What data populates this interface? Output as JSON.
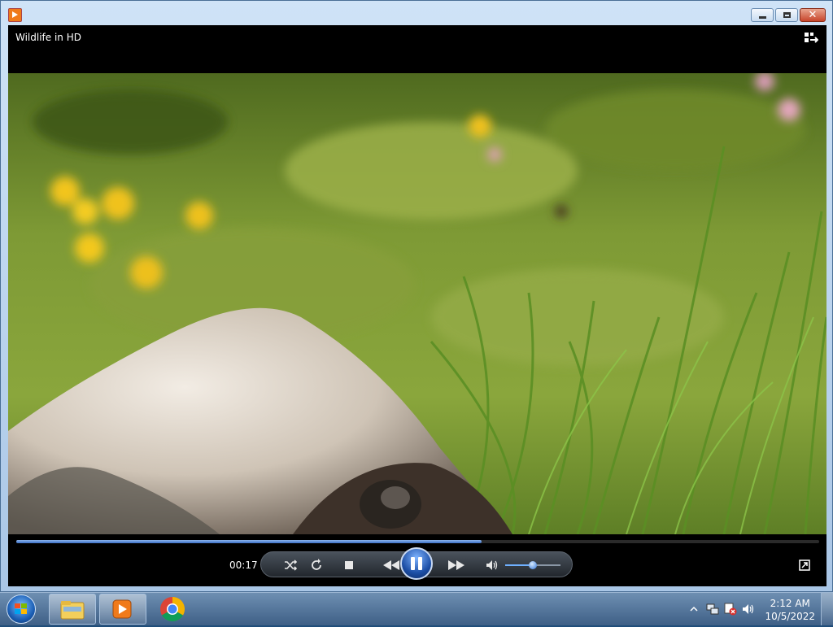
{
  "window": {
    "app_icon": "media-player-icon",
    "minimize_icon": "minimize-icon",
    "maximize_icon": "maximize-icon",
    "close_label": "✕"
  },
  "player": {
    "title": "Wildlife in HD",
    "switch_library_icon": "switch-to-library-icon",
    "seek_progress": 0.58,
    "elapsed": "00:17",
    "controls": {
      "shuffle_icon": "shuffle-icon",
      "repeat_icon": "repeat-icon",
      "stop_icon": "stop-icon",
      "previous_icon": "previous-icon",
      "pause_icon": "pause-icon",
      "next_icon": "next-icon",
      "mute_icon": "volume-icon"
    },
    "volume": 0.5,
    "fullscreen_icon": "fullscreen-icon"
  },
  "taskbar": {
    "start_icon": "windows-start-icon",
    "items": [
      "file-explorer-icon",
      "media-player-icon",
      "chrome-icon"
    ],
    "tray_icons": [
      "show-hidden-icons-chevron",
      "network-icon",
      "action-center-icon",
      "volume-icon"
    ],
    "time": "2:12 AM",
    "date": "10/5/2022"
  }
}
